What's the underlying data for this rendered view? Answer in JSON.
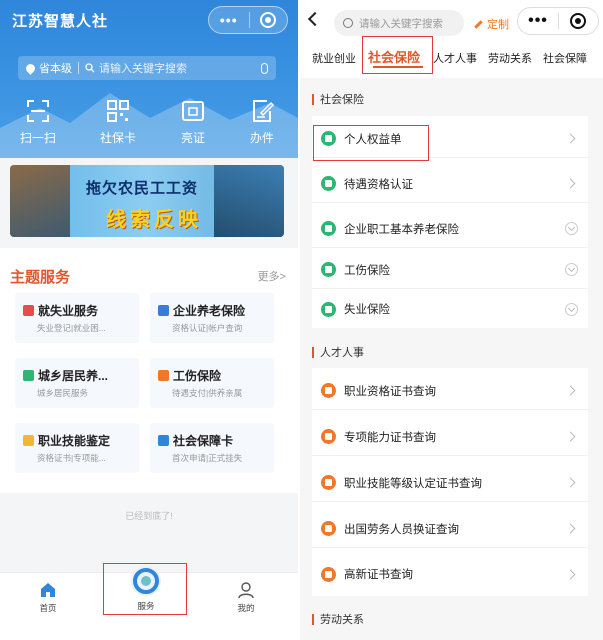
{
  "left": {
    "app_title": "江苏智慧人社",
    "capsule": {
      "more": "•••",
      "target_icon": "target-icon"
    },
    "search": {
      "location": "省本级",
      "placeholder": "请输入关键字搜索"
    },
    "quick_actions": [
      {
        "label": "扫一扫",
        "icon": "scan-icon"
      },
      {
        "label": "社保卡",
        "icon": "qrcode-icon"
      },
      {
        "label": "亮证",
        "icon": "id-card-icon"
      },
      {
        "label": "办件",
        "icon": "edit-doc-icon"
      }
    ],
    "banner": {
      "line1": "拖欠农民工工资",
      "line2": "线索反映"
    },
    "themes": {
      "title": "主题服务",
      "more": "更多>",
      "cards": [
        {
          "title": "就失业服务",
          "sub": "失业登记|就业困...",
          "color": "#e84b4b"
        },
        {
          "title": "企业养老保险",
          "sub": "资格认证|帐户查询",
          "color": "#3a7bd5"
        },
        {
          "title": "城乡居民养...",
          "sub": "城乡居民服务",
          "color": "#2bb673"
        },
        {
          "title": "工伤保险",
          "sub": "待遇支付|供养亲属",
          "color": "#f0782a"
        },
        {
          "title": "职业技能鉴定",
          "sub": "资格证书|专项能...",
          "color": "#f2b632"
        },
        {
          "title": "社会保障卡",
          "sub": "首次申请|正式挂失",
          "color": "#2f86db"
        }
      ]
    },
    "footer_note": "已经到底了!",
    "tabbar": [
      {
        "label": "首页",
        "icon": "home-icon"
      },
      {
        "label": "服务",
        "icon": "service-logo-icon"
      },
      {
        "label": "我的",
        "icon": "user-icon"
      }
    ]
  },
  "right": {
    "search_placeholder": "请输入关键字搜索",
    "custom_label": "定制",
    "capsule_more": "•••",
    "categories": [
      {
        "label": "就业创业",
        "active": false
      },
      {
        "label": "社会保险",
        "active": true
      },
      {
        "label": "人才人事",
        "active": false
      },
      {
        "label": "劳动关系",
        "active": false
      },
      {
        "label": "社会保障",
        "active": false
      }
    ],
    "sections": [
      {
        "title": "社会保险",
        "items": [
          {
            "label": "个人权益单",
            "icon_color": "green",
            "chevron": "arrow"
          },
          {
            "label": "待遇资格认证",
            "icon_color": "green",
            "chevron": "arrow"
          },
          {
            "label": "企业职工基本养老保险",
            "icon_color": "green",
            "chevron": "circle"
          },
          {
            "label": "工伤保险",
            "icon_color": "green",
            "chevron": "circle"
          },
          {
            "label": "失业保险",
            "icon_color": "green",
            "chevron": "circle"
          }
        ]
      },
      {
        "title": "人才人事",
        "items": [
          {
            "label": "职业资格证书查询",
            "icon_color": "orange",
            "chevron": "arrow"
          },
          {
            "label": "专项能力证书查询",
            "icon_color": "orange",
            "chevron": "arrow"
          },
          {
            "label": "职业技能等级认定证书查询",
            "icon_color": "orange",
            "chevron": "arrow"
          },
          {
            "label": "出国劳务人员换证查询",
            "icon_color": "orange",
            "chevron": "arrow"
          },
          {
            "label": "高新证书查询",
            "icon_color": "orange",
            "chevron": "arrow"
          }
        ]
      },
      {
        "title": "劳动关系",
        "items": []
      }
    ]
  },
  "colors": {
    "accent": "#e0572d",
    "highlight_box": "#e23b3b",
    "header_blue": "#2f86db"
  }
}
